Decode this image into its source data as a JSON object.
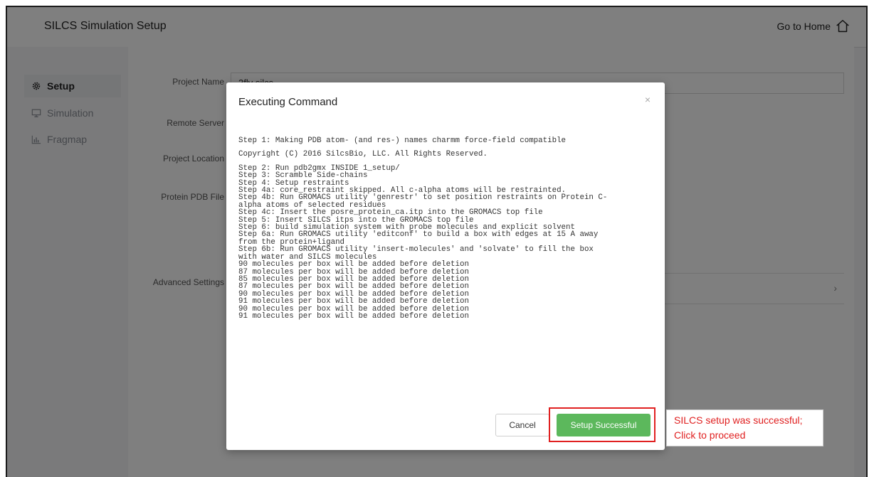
{
  "app": {
    "title": "SILCS Simulation Setup",
    "home_label": "Go to Home"
  },
  "sidebar": {
    "items": [
      {
        "label": "Setup",
        "icon": "gear-icon",
        "active": true
      },
      {
        "label": "Simulation",
        "icon": "monitor-icon",
        "active": false
      },
      {
        "label": "Fragmap",
        "icon": "bar-chart-icon",
        "active": false
      }
    ]
  },
  "form": {
    "project_name_label": "Project Name",
    "project_name_value": "3fly silcs",
    "remote_server_label": "Remote Server",
    "project_location_label": "Project Location",
    "protein_pdb_label": "Protein PDB File",
    "advanced_settings_label": "Advanced Settings"
  },
  "modal": {
    "title": "Executing Command",
    "close_symbol": "×",
    "log_lines": [
      "Step 1: Making PDB atom- (and res-) names charmm force-field compatible",
      "Copyright (C) 2016 SilcsBio, LLC. All Rights Reserved.",
      "Step 2: Run pdb2gmx INSIDE 1_setup/",
      "Step 3: Scramble Side-chains",
      "Step 4: Setup restraints",
      "Step 4a: core_restraint skipped. All c-alpha atoms will be restrainted.",
      "Step 4b: Run GROMACS utility 'genrestr' to set position restraints on Protein C-",
      "alpha atoms of selected residues",
      "Step 4c: Insert the posre_protein_ca.itp into the GROMACS top file",
      "Step 5: Insert SILCS itps into the GROMACS top file",
      "Step 6: build simulation system with probe molecules and explicit solvent",
      "Step 6a: Run GROMACS utility 'editconf' to build a box with edges at 15 A away",
      "from the protein+ligand",
      "Step 6b: Run GROMACS utility 'insert-molecules' and 'solvate' to fill the box",
      "with water and SILCS molecules",
      "90 molecules per box will be added before deletion",
      "87 molecules per box will be added before deletion",
      "85 molecules per box will be added before deletion",
      "87 molecules per box will be added before deletion",
      "90 molecules per box will be added before deletion",
      "91 molecules per box will be added before deletion",
      "90 molecules per box will be added before deletion",
      "91 molecules per box will be added before deletion"
    ],
    "cancel_label": "Cancel",
    "success_label": "Setup Successful"
  },
  "annotation": {
    "line1": "SILCS setup was successful;",
    "line2": "Click to proceed",
    "color": "#e02020"
  },
  "colors": {
    "success": "#5cb85c",
    "annotation_red": "#e02020"
  }
}
